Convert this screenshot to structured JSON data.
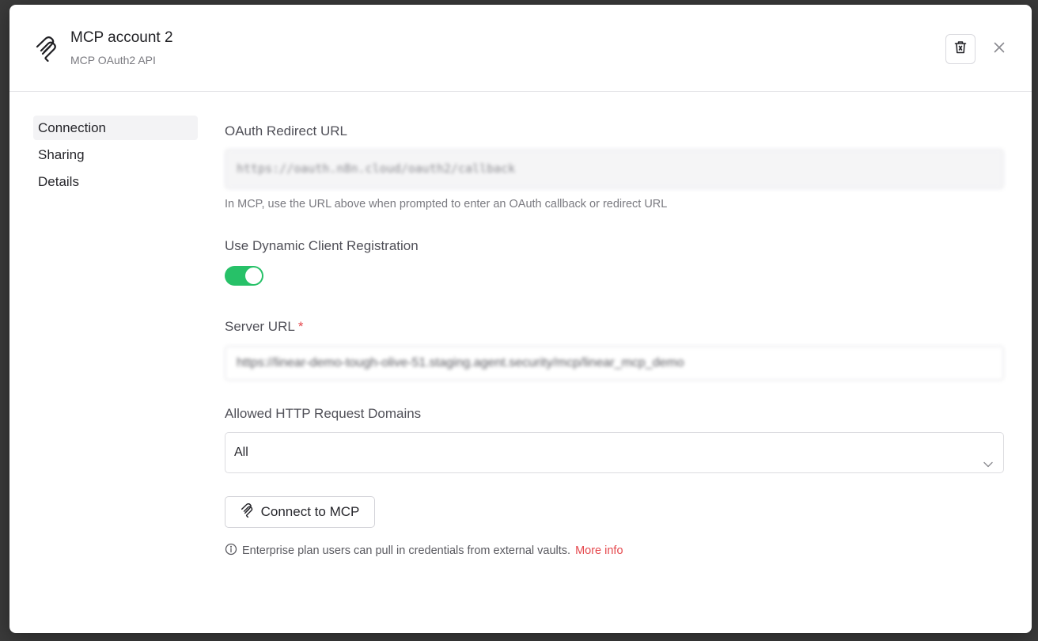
{
  "header": {
    "title": "MCP account 2",
    "subtitle": "MCP OAuth2 API"
  },
  "sidebar": {
    "items": [
      {
        "label": "Connection",
        "active": true
      },
      {
        "label": "Sharing",
        "active": false
      },
      {
        "label": "Details",
        "active": false
      }
    ]
  },
  "form": {
    "redirect_label": "OAuth Redirect URL",
    "redirect_value": "https://oauth.n8n.cloud/oauth2/callback",
    "redirect_hint": "In MCP, use the URL above when prompted to enter an OAuth callback or redirect URL",
    "dcr_label": "Use Dynamic Client Registration",
    "dcr_enabled": true,
    "server_url_label": "Server URL",
    "server_url_required_mark": "*",
    "server_url_value": "https://linear-demo-tough-olive-51.staging.agent.security/mcp/linear_mcp_demo",
    "domains_label": "Allowed HTTP Request Domains",
    "domains_value": "All",
    "connect_label": "Connect to MCP",
    "note_text": "Enterprise plan users can pull in credentials from external vaults.",
    "note_link": "More info"
  },
  "colors": {
    "accent_red": "#e5484d",
    "toggle_on": "#27c168"
  },
  "icons": {
    "header": "mcp-logo-icon",
    "delete": "trash-icon",
    "close": "close-icon",
    "select": "chevron-down-icon",
    "connect": "mcp-logo-icon",
    "note": "info-icon"
  }
}
